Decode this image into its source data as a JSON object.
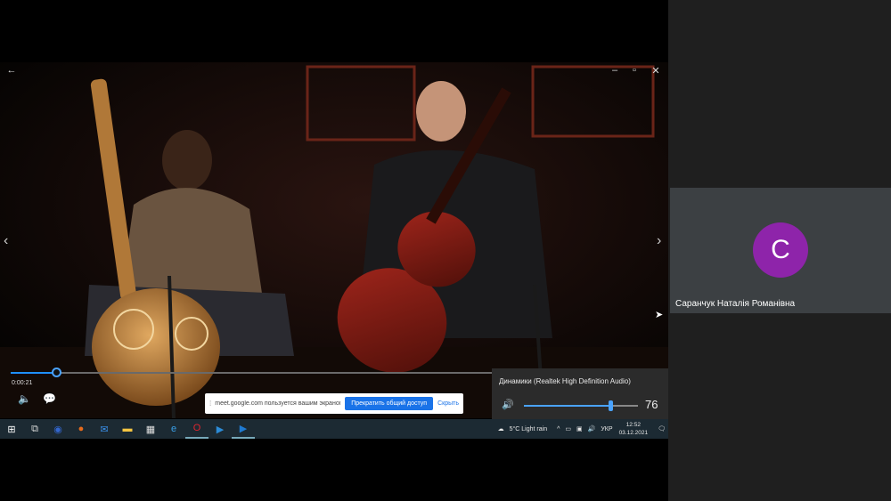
{
  "player": {
    "time": "0:00:21",
    "progress": 0.07
  },
  "share_banner": {
    "message": "meet.google.com пользуется вашим экраном.",
    "stop_label": "Прекратить общий доступ",
    "hide_label": "Скрыть"
  },
  "volume": {
    "device": "Динамики (Realtek High Definition Audio)",
    "level": 76,
    "level_text": "76"
  },
  "tray": {
    "weather": "5°C  Light rain",
    "language": "УКР",
    "time": "12:52",
    "date": "03.12.2021"
  },
  "participant": {
    "initial": "С",
    "name": "Саранчук Наталія Романівна",
    "avatar_color": "#8e24aa"
  },
  "taskbar_icons": [
    {
      "name": "windows-start-icon",
      "color": "#ffffff"
    },
    {
      "name": "task-view-icon",
      "color": "#dddddd"
    },
    {
      "name": "edge-icon",
      "color": "#36c"
    },
    {
      "name": "firefox-icon",
      "color": "#e76b1c"
    },
    {
      "name": "mail-icon",
      "color": "#3a8ee6"
    },
    {
      "name": "file-explorer-icon",
      "color": "#f5c542"
    },
    {
      "name": "store-icon",
      "color": "#e0e0e0"
    },
    {
      "name": "ie-icon",
      "color": "#3aa0e8"
    },
    {
      "name": "opera-icon",
      "color": "#e0252e"
    },
    {
      "name": "media-player-icon",
      "color": "#2c8bd6"
    },
    {
      "name": "movies-tv-icon",
      "color": "#1f7ad1"
    }
  ]
}
